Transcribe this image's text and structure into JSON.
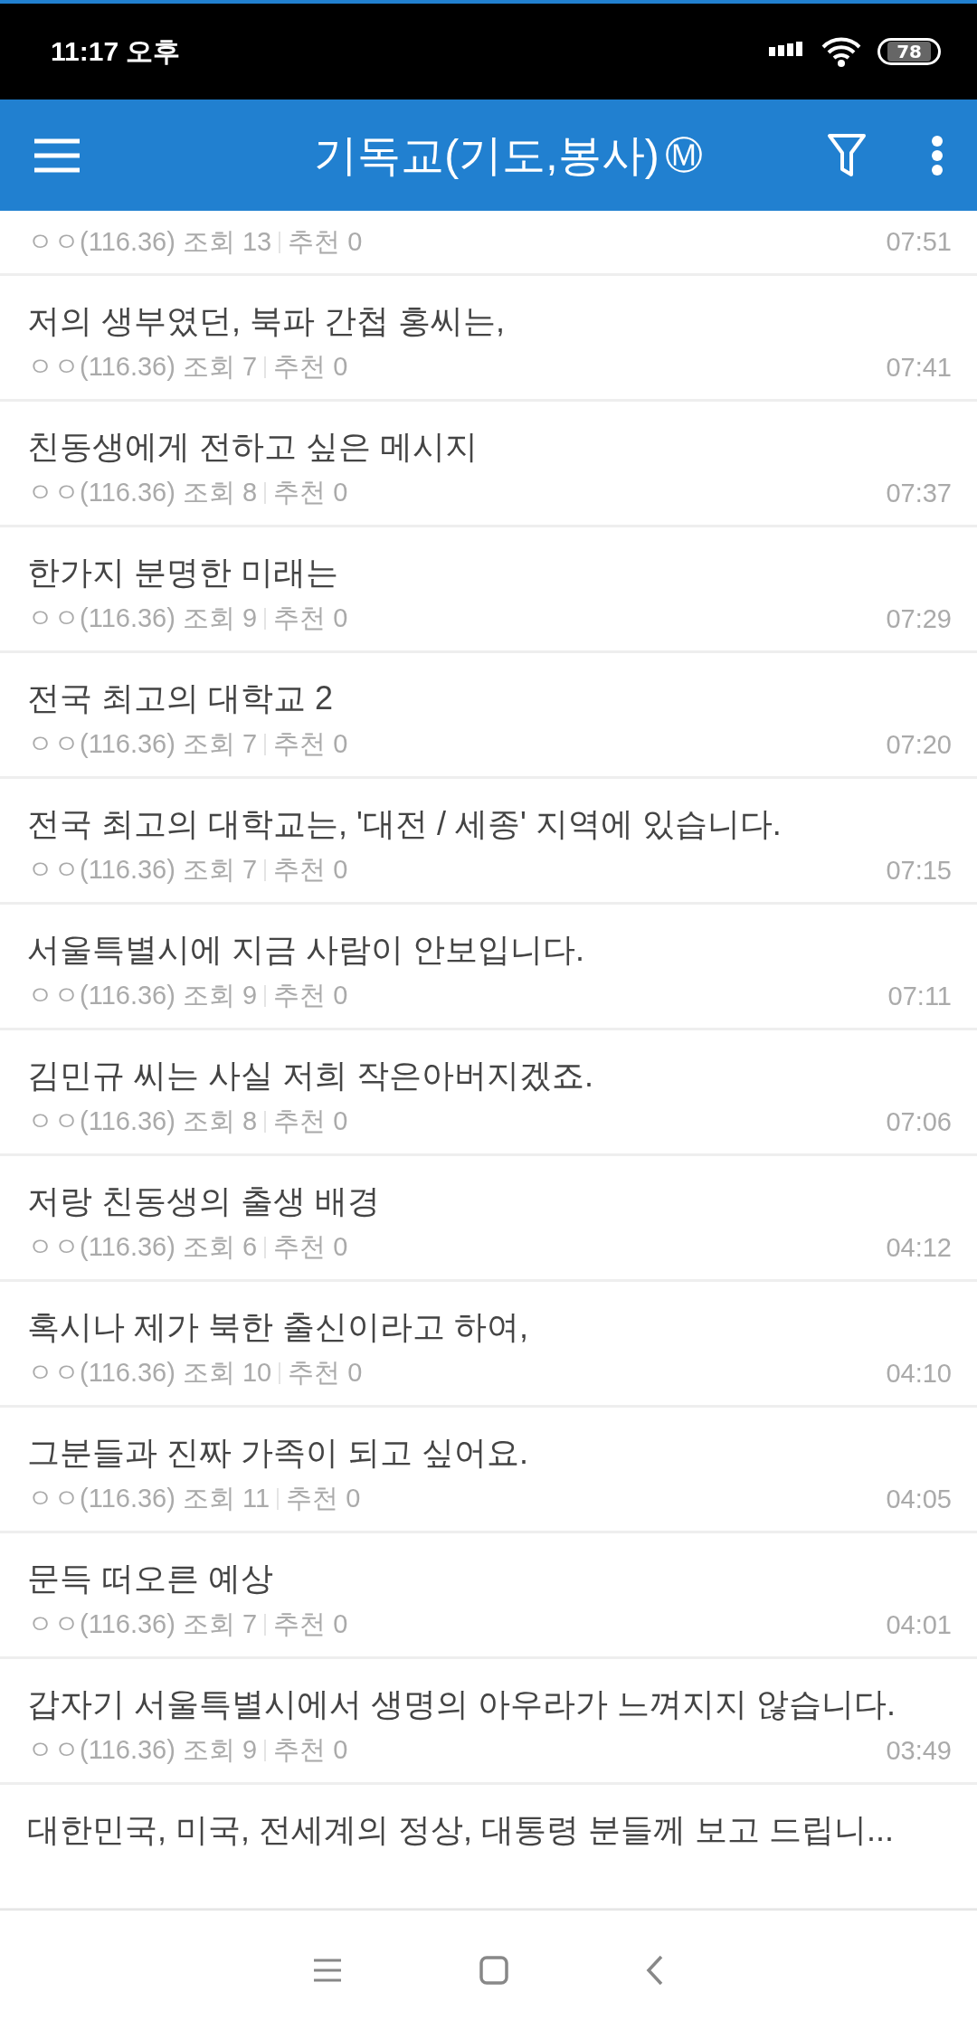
{
  "status_bar": {
    "time": "11:17 오후",
    "battery": "78"
  },
  "header": {
    "title": "기독교(기도,봉사)",
    "badge": "Ⓜ"
  },
  "posts": [
    {
      "author": "ㅇㅇ(116.36)",
      "views": "조회 13",
      "likes": "추천 0",
      "time": "07:51"
    },
    {
      "title": "저의 생부였던, 북파 간첩 홍씨는,",
      "author": "ㅇㅇ(116.36)",
      "views": "조회 7",
      "likes": "추천 0",
      "time": "07:41"
    },
    {
      "title": "친동생에게 전하고 싶은 메시지",
      "author": "ㅇㅇ(116.36)",
      "views": "조회 8",
      "likes": "추천 0",
      "time": "07:37"
    },
    {
      "title": "한가지 분명한 미래는",
      "author": "ㅇㅇ(116.36)",
      "views": "조회 9",
      "likes": "추천 0",
      "time": "07:29"
    },
    {
      "title": "전국 최고의 대학교 2",
      "author": "ㅇㅇ(116.36)",
      "views": "조회 7",
      "likes": "추천 0",
      "time": "07:20"
    },
    {
      "title": "전국 최고의 대학교는, '대전 / 세종' 지역에 있습니다.",
      "author": "ㅇㅇ(116.36)",
      "views": "조회 7",
      "likes": "추천 0",
      "time": "07:15"
    },
    {
      "title": "서울특별시에 지금 사람이 안보입니다.",
      "author": "ㅇㅇ(116.36)",
      "views": "조회 9",
      "likes": "추천 0",
      "time": "07:11"
    },
    {
      "title": "김민규 씨는 사실 저희 작은아버지겠죠.",
      "author": "ㅇㅇ(116.36)",
      "views": "조회 8",
      "likes": "추천 0",
      "time": "07:06"
    },
    {
      "title": "저랑 친동생의 출생 배경",
      "author": "ㅇㅇ(116.36)",
      "views": "조회 6",
      "likes": "추천 0",
      "time": "04:12"
    },
    {
      "title": "혹시나 제가 북한 출신이라고 하여,",
      "author": "ㅇㅇ(116.36)",
      "views": "조회 10",
      "likes": "추천 0",
      "time": "04:10"
    },
    {
      "title": "그분들과 진짜 가족이 되고 싶어요.",
      "author": "ㅇㅇ(116.36)",
      "views": "조회 11",
      "likes": "추천 0",
      "time": "04:05"
    },
    {
      "title": "문득 떠오른 예상",
      "author": "ㅇㅇ(116.36)",
      "views": "조회 7",
      "likes": "추천 0",
      "time": "04:01"
    },
    {
      "title": "갑자기 서울특별시에서 생명의 아우라가 느껴지지 않습니다.",
      "author": "ㅇㅇ(116.36)",
      "views": "조회 9",
      "likes": "추천 0",
      "time": "03:49"
    },
    {
      "title": "대한민국, 미국, 전세계의 정상, 대통령 분들께 보고 드립니..."
    }
  ]
}
